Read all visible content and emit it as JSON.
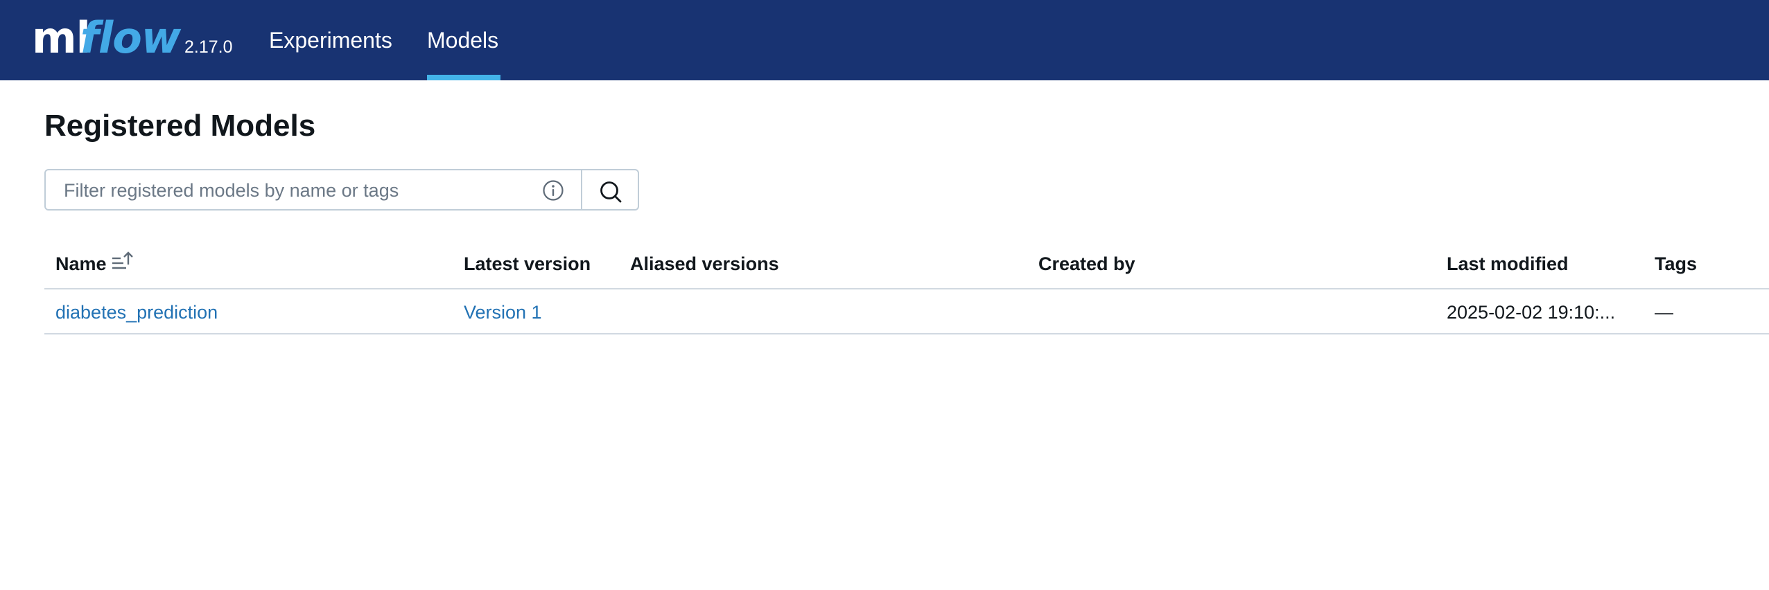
{
  "header": {
    "logo_ml": "ml",
    "logo_flow": "flow",
    "version": "2.17.0",
    "nav": [
      {
        "label": "Experiments",
        "active": false
      },
      {
        "label": "Models",
        "active": true
      }
    ],
    "background_color": "#183372",
    "accent_color": "#43b3e8"
  },
  "page": {
    "title": "Registered Models"
  },
  "search": {
    "placeholder": "Filter registered models by name or tags",
    "value": "",
    "info_icon": "info-icon",
    "button_icon": "search-icon"
  },
  "table": {
    "columns": [
      "Name",
      "Latest version",
      "Aliased versions",
      "Created by",
      "Last modified",
      "Tags"
    ],
    "sort_icon": "sort-ascending-icon",
    "rows": [
      {
        "name": "diabetes_prediction",
        "latest_version": "Version 1",
        "aliased_versions": "",
        "created_by": "",
        "last_modified": "2025-02-02 19:10:...",
        "tags": "—"
      }
    ],
    "link_color": "#2272b4"
  }
}
